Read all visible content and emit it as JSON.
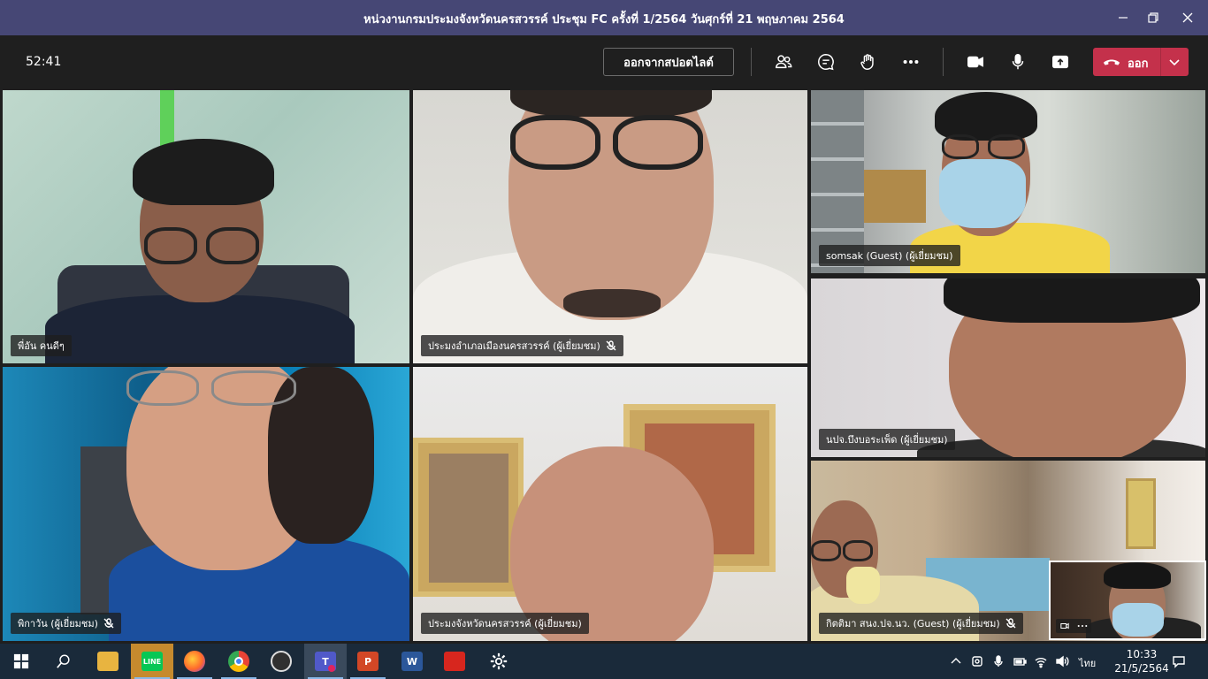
{
  "window": {
    "title": "หน่วงานกรมประมงจังหวัดนครสวรรค์ ประชุม FC ครั้งที่ 1/2564 วันศุกร์ที่ 21 พฤษภาคม 2564"
  },
  "toolbar": {
    "timer": "52:41",
    "spotlight_label": "ออกจากสปอตไลต์",
    "leave_label": "ออก"
  },
  "participants": [
    {
      "name": "พี่อัน คนดีๆ",
      "muted": false
    },
    {
      "name": "ประมงอำเภอเมืองนครสวรรค์ (ผู้เยี่ยมชม)",
      "muted": true
    },
    {
      "name": "somsak (Guest) (ผู้เยี่ยมชม)",
      "muted": false
    },
    {
      "name": "นปจ.บึงบอระเพ็ด (ผู้เยี่ยมชม)",
      "muted": false
    },
    {
      "name": "พิกาวัน (ผู้เยี่ยมชม)",
      "muted": true
    },
    {
      "name": "ประมงจังหวัดนครสวรรค์ (ผู้เยี่ยมชม)",
      "muted": false
    },
    {
      "name": "กิตติมา สนง.ปจ.นว. (Guest) (ผู้เยี่ยมชม)",
      "muted": true
    }
  ],
  "taskbar": {
    "line_label": "LINE",
    "teams_label": "T",
    "ppt_label": "P",
    "word_label": "W",
    "language": "ไทย",
    "time": "10:33",
    "date": "21/5/2564"
  },
  "colors": {
    "title_bar": "#464775",
    "leave_button": "#c4314b",
    "meeting_background": "#1f1f1f",
    "taskbar": "#1a2a3a"
  }
}
